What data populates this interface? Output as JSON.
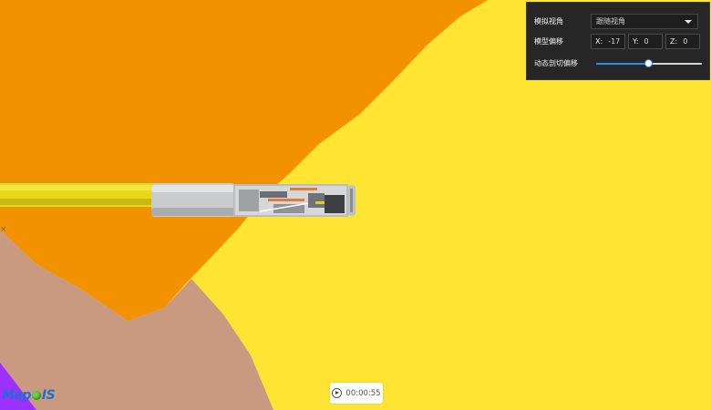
{
  "panel": {
    "view_label": "模拟视角",
    "view_value": "跟随视角",
    "offset_label": "模型偏移",
    "offset": {
      "x_key": "X:",
      "x_value": "-17",
      "y_key": "Y:",
      "y_value": "0",
      "z_key": "Z:",
      "z_value": "0"
    },
    "clip_label": "动态剖切偏移",
    "clip_fraction": 0.5
  },
  "player": {
    "time": "00:00:55"
  },
  "logo": {
    "text_left": "Map",
    "text_right": "IS"
  },
  "colors": {
    "ground_yellow": "#ffe433",
    "ground_orange": "#f39200",
    "ground_tan": "#c99a80",
    "corner_purple": "#9b30ff",
    "panel_bg": "#262626",
    "slider_accent": "#2d8cf0"
  }
}
